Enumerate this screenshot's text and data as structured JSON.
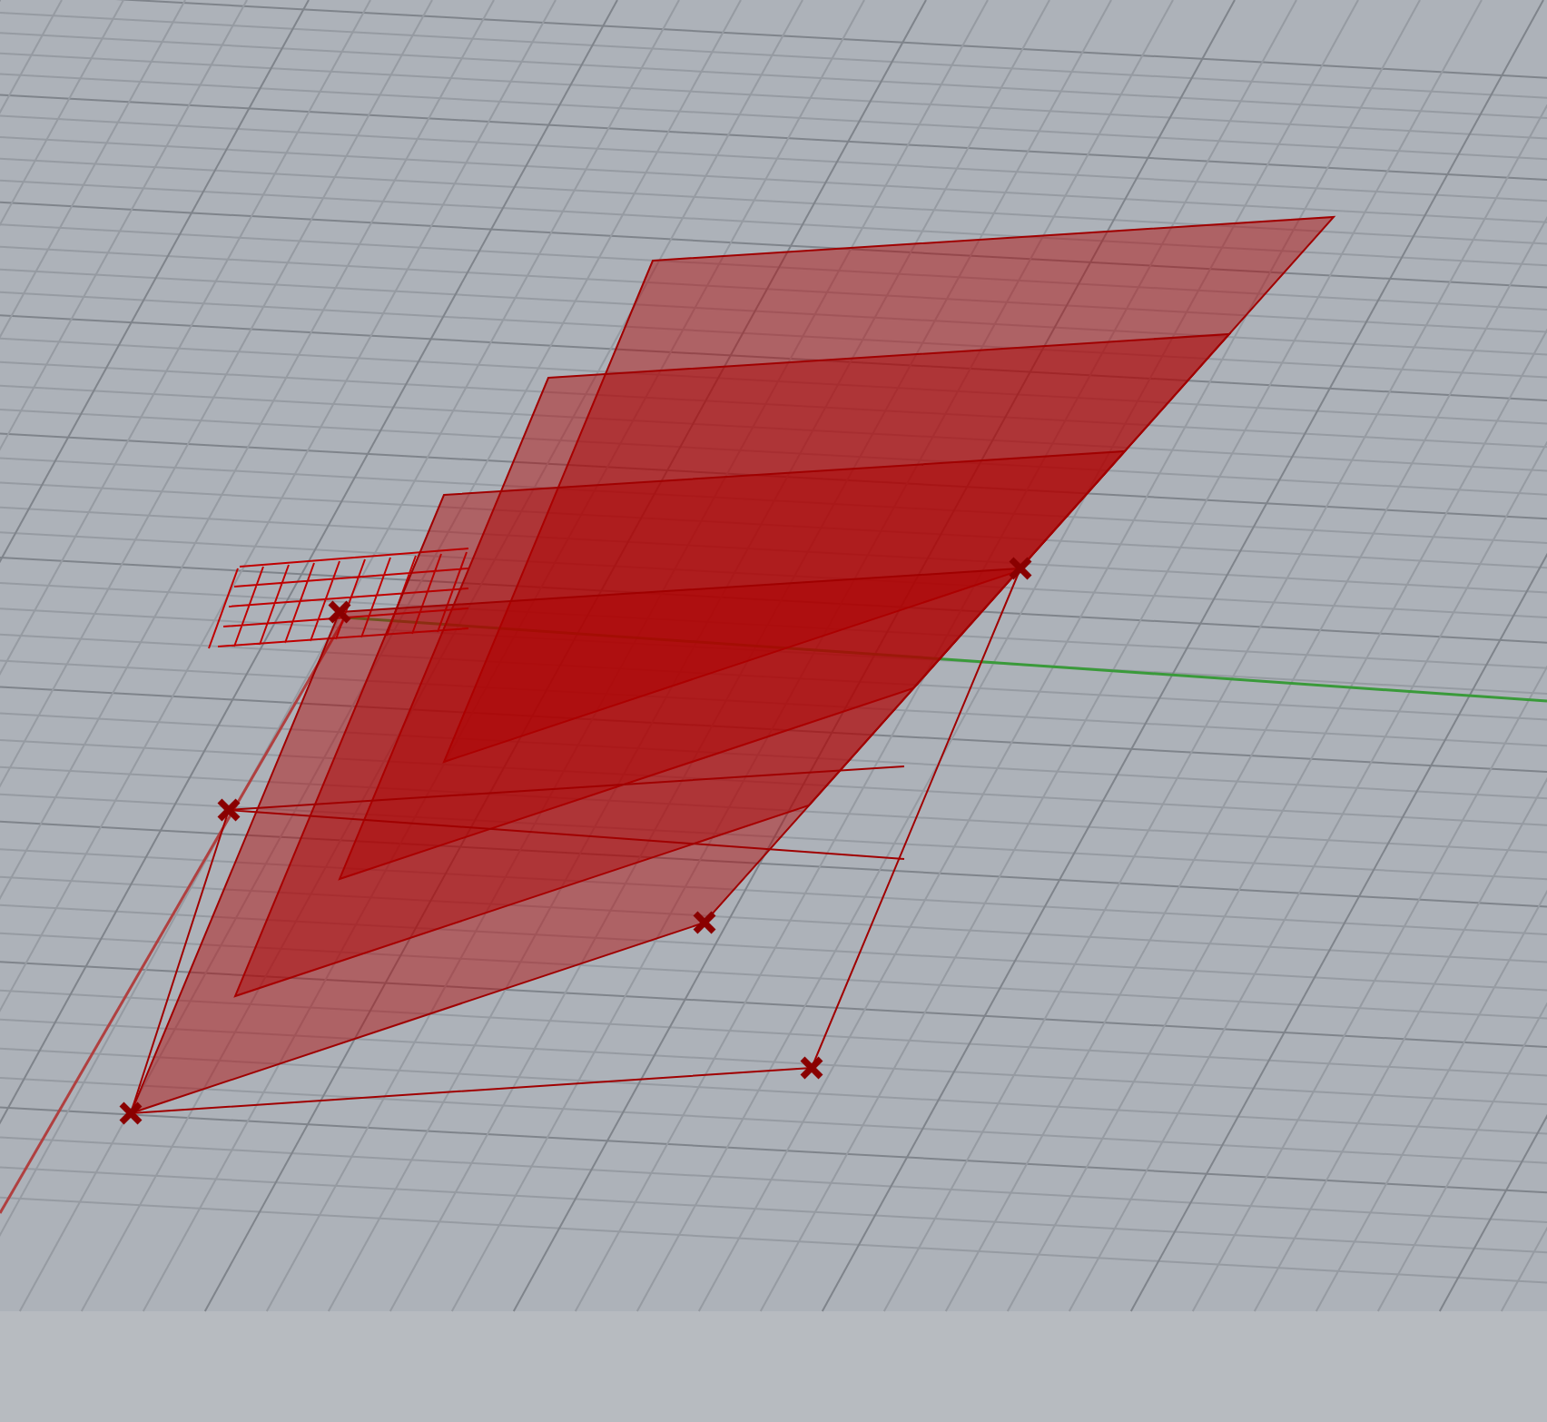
{
  "viewport": {
    "grid": true,
    "axes": true,
    "control_points": true
  }
}
